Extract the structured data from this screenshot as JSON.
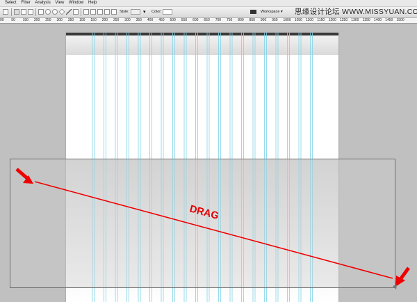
{
  "menu": [
    "Select",
    "Filter",
    "Analysis",
    "View",
    "Window",
    "Help"
  ],
  "options": {
    "style_label": "Style:",
    "color_label": "Color:",
    "workspace_label": "Workspace"
  },
  "watermark": "思缘设计论坛 WWW.MISSYUAN.COM",
  "ruler": [
    "00",
    "50",
    "150",
    "200",
    "250",
    "300",
    "350",
    "100",
    "150",
    "200",
    "250",
    "300",
    "350",
    "400",
    "450",
    "500",
    "550",
    "600",
    "650",
    "700",
    "750",
    "800",
    "850",
    "900",
    "950",
    "1000",
    "1050",
    "1100",
    "1150",
    "1200",
    "1250",
    "1300",
    "1350",
    "1400",
    "1450",
    "1500"
  ],
  "canvas": {
    "drag_label": "DRAG"
  },
  "colors": {
    "guide": "#7fd4e6",
    "arrow": "#ee0000",
    "background": "#c0c0c0"
  },
  "icons": [
    "marquee-icon",
    "rect-shape-icon",
    "rounded-rect-icon",
    "ellipse-icon",
    "polygon-icon",
    "line-icon",
    "custom-shape-icon",
    "shape-layer-icon",
    "path-icon",
    "fill-pixels-icon",
    "add-icon",
    "subtract-icon",
    "intersect-icon",
    "exclude-icon",
    "link-icon",
    "workspace-icon"
  ]
}
